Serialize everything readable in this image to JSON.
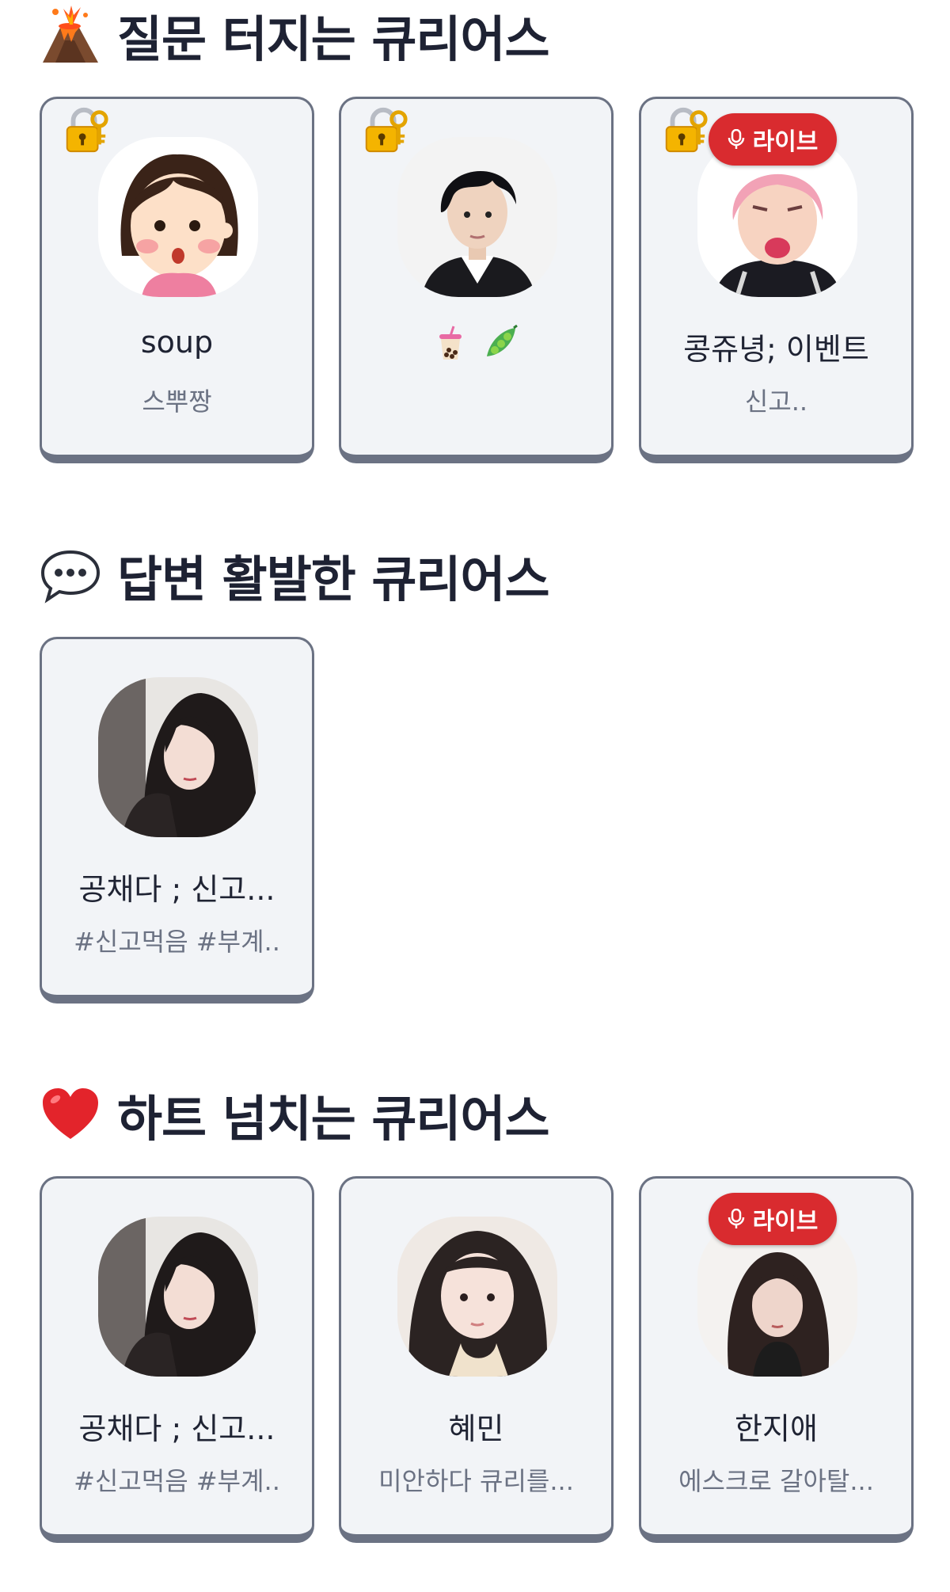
{
  "sections": [
    {
      "title": "질문 터지는 큐리어스",
      "icon": "volcano-icon",
      "cards": [
        {
          "name": "soup",
          "desc": "스뿌짱",
          "locked": true,
          "live": false,
          "avatar": "cartoon-girl-avatar"
        },
        {
          "name": "🧋 🫛",
          "desc": "",
          "locked": true,
          "live": false,
          "avatar": "black-hair-boy-avatar"
        },
        {
          "name": "콩쥬녕; 이벤트",
          "desc": "신고..",
          "locked": true,
          "live": true,
          "avatar": "pink-hair-avatar"
        }
      ]
    },
    {
      "title": "답변 활발한 큐리어스",
      "icon": "speech-bubble-icon",
      "cards": [
        {
          "name": "공채다 ; 신고...",
          "desc": "#신고먹음 #부계..",
          "locked": false,
          "live": false,
          "avatar": "dark-hair-girl-avatar"
        }
      ]
    },
    {
      "title": "하트 넘치는 큐리어스",
      "icon": "red-heart-icon",
      "cards": [
        {
          "name": "공채다 ; 신고...",
          "desc": "#신고먹음 #부계..",
          "locked": false,
          "live": false,
          "avatar": "dark-hair-girl-avatar"
        },
        {
          "name": "혜민",
          "desc": "미안하다 큐리를...",
          "locked": false,
          "live": false,
          "avatar": "long-hair-girl-avatar"
        },
        {
          "name": "한지애",
          "desc": "에스크로 갈아탈...",
          "locked": false,
          "live": true,
          "avatar": "wavy-hair-girl-avatar"
        }
      ]
    }
  ],
  "live_label": "라이브",
  "colors": {
    "card_bg": "#f2f4f7",
    "card_border": "#6b7283",
    "live_red": "#d92b2f",
    "title": "#1e2233",
    "desc": "#6b7283"
  }
}
